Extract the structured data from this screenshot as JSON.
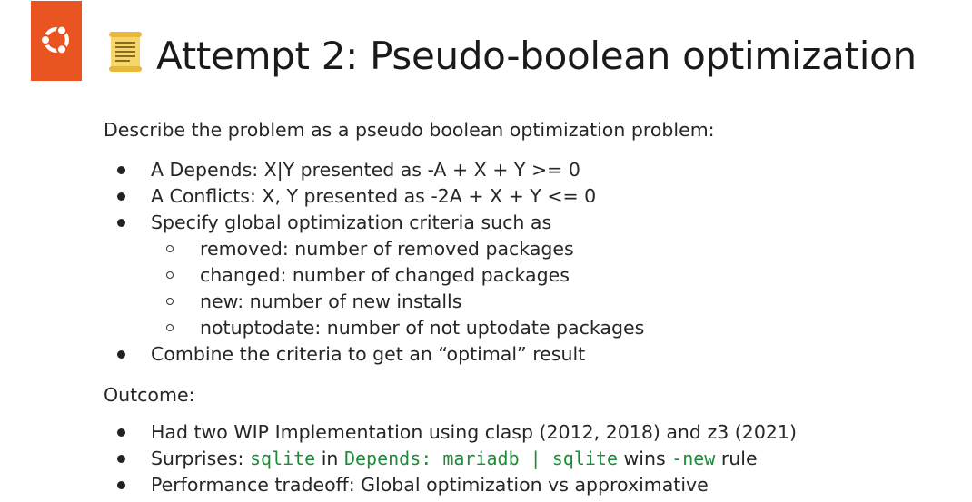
{
  "slide": {
    "title": "Attempt 2: Pseudo-boolean optimization",
    "intro": "Describe the problem as a pseudo boolean optimization problem:",
    "bullets": [
      "A Depends: X|Y presented as -A + X + Y >= 0",
      "A Conflicts: X, Y presented as -2A + X + Y <= 0",
      "Specify global optimization criteria such as"
    ],
    "sub_bullets": [
      "removed: number of removed packages",
      "changed: number of changed packages",
      "new: number of new installs",
      "notuptodate: number of not uptodate packages"
    ],
    "combine": "Combine the criteria to get an “optimal” result",
    "outcome_heading": "Outcome:",
    "outcome_1": "Had two WIP Implementation using clasp (2012, 2018) and z3 (2021)",
    "outcome_2": {
      "prefix": "Surprises: ",
      "code1": "sqlite",
      "mid1": " in ",
      "code2": "Depends: mariadb | sqlite",
      "mid2": " wins ",
      "code3": "-new",
      "suffix": " rule"
    },
    "outcome_3": "Performance tradeoff: Global optimization vs approximative"
  },
  "colors": {
    "brand": "#e95420",
    "code": "#1e8a3a",
    "scroll": "#f2c94c"
  },
  "icons": {
    "logo": "ubuntu-logo-icon",
    "emoji": "scroll-icon"
  }
}
